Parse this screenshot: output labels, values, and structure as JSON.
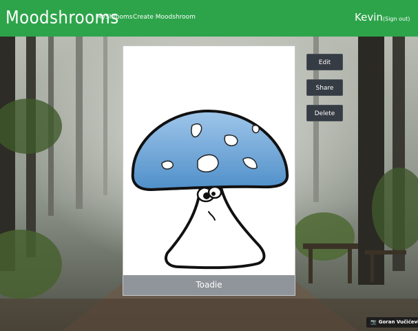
{
  "app": {
    "brand": "Moodshrooms"
  },
  "nav": {
    "myshrooms": "MyShrooms",
    "create": "Create Moodshroom"
  },
  "user": {
    "name": "Kevin",
    "sign_out": "(Sign out)"
  },
  "card": {
    "name": "Toadie",
    "icon": "mushroom-illustration",
    "cap_color": "#5b9bd5"
  },
  "actions": {
    "edit": "Edit",
    "share": "Share",
    "delete": "Delete"
  },
  "credit": {
    "text": "Goran Vučićević",
    "icon": "camera-icon"
  },
  "colors": {
    "navbar": "#2da44a",
    "button": "#363c43",
    "card_footer": "#8f959a"
  }
}
